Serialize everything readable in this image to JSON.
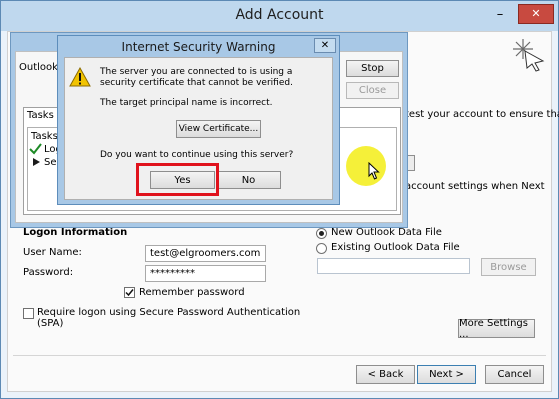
{
  "main_window": {
    "title": "Add Account",
    "minimize_glyph": "–",
    "close_glyph": "✕",
    "status_text": "test your account to ensure that",
    "status_text_2": "account settings when Next",
    "logon_section": "Logon Information",
    "user_name_label": "User Name:",
    "user_name_value": "test@elgroomers.com",
    "password_label": "Password:",
    "password_value": "*********",
    "remember_password": "Remember password",
    "spa_line1": "Require logon using Secure Password Authentication",
    "spa_line2": "(SPA)",
    "new_data_file": "New Outlook Data File",
    "existing_data_file": "Existing Outlook Data File",
    "browse": "Browse",
    "more_settings": "More Settings ...",
    "back": "< Back",
    "next": "Next >",
    "cancel": "Cancel"
  },
  "progress_window": {
    "outlook_label": "Outlook",
    "stop": "Stop",
    "close": "Close",
    "tasks_tab": "Tasks",
    "tasks_header": "Tasks",
    "task1": "Log",
    "task2": "Ser"
  },
  "warning_dialog": {
    "title": "Internet Security Warning",
    "close_glyph": "✕",
    "message1": "The server you are connected to is using a security certificate that cannot be verified.",
    "message2": "The target principal name is incorrect.",
    "view_certificate": "View Certificate...",
    "question": "Do you want to continue using this server?",
    "yes": "Yes",
    "no": "No"
  },
  "colors": {
    "highlight_box": "#e0121c",
    "cursor_highlight": "#f4ee24",
    "title_bar": "#a8c8e6"
  }
}
